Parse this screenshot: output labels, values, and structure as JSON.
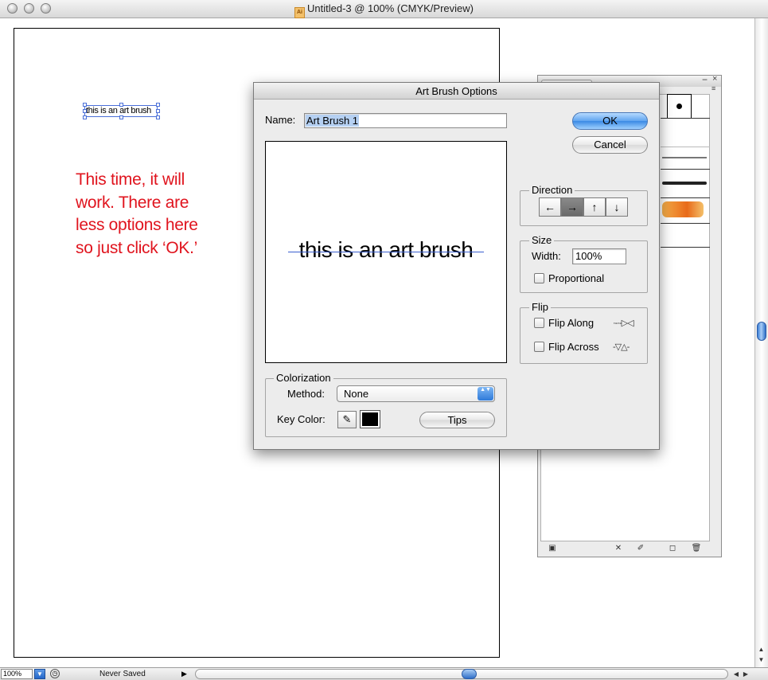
{
  "window": {
    "title": "Untitled-3 @ 100% (CMYK/Preview)",
    "doc_icon_glyph": "Ai"
  },
  "artboard": {
    "selected_text": "this is an art brush"
  },
  "annotation": {
    "lines": [
      "This time, it will",
      "work. There are",
      "less options here",
      "so just click ‘OK.’"
    ],
    "color": "#e0141e"
  },
  "dialog": {
    "title": "Art Brush Options",
    "name_label": "Name:",
    "name_value": "Art Brush 1",
    "ok_label": "OK",
    "cancel_label": "Cancel",
    "preview_text": "this is an art brush",
    "direction": {
      "legend": "Direction",
      "buttons": [
        "←",
        "→",
        "↑",
        "↓"
      ],
      "selected": "→"
    },
    "size": {
      "legend": "Size",
      "width_label": "Width:",
      "width_value": "100%",
      "proportional_label": "Proportional"
    },
    "flip": {
      "legend": "Flip",
      "along_label": "Flip Along",
      "across_label": "Flip Across"
    },
    "colorization": {
      "legend": "Colorization",
      "method_label": "Method:",
      "method_value": "None",
      "key_color_label": "Key Color:",
      "key_color": "#000000",
      "tips_label": "Tips"
    }
  },
  "status": {
    "zoom": "100%",
    "save_state": "Never Saved"
  },
  "icons": {
    "min": "−",
    "close": "×",
    "panel_menu": "≡",
    "status_arrow": "▶",
    "zoom_arrow": "▼",
    "scroll_up": "▲",
    "scroll_down": "▼",
    "scroll_left": "◀",
    "scroll_right": "▶",
    "eyedropper": "✎",
    "select_arrows": "▲▼"
  },
  "colors": {
    "accent_blue": "#3b8ae4",
    "selection_blue": "#4a6fd8"
  }
}
